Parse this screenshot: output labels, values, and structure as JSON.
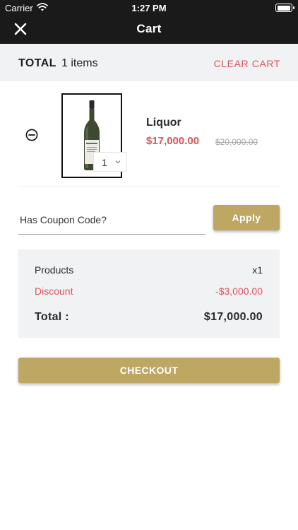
{
  "status_bar": {
    "carrier": "Carrier",
    "time": "1:27 PM"
  },
  "nav": {
    "title": "Cart",
    "close_icon": "close-icon"
  },
  "summary": {
    "total_label": "TOTAL",
    "items_count": "1 items",
    "clear_cart": "CLEAR CART"
  },
  "cart": {
    "items": [
      {
        "name": "Liquor",
        "price": "$17,000.00",
        "original_price": "$20,000.00",
        "quantity": "1"
      }
    ]
  },
  "coupon": {
    "placeholder": "Has Coupon Code?",
    "apply_label": "Apply"
  },
  "totals": {
    "products_label": "Products",
    "products_value": "x1",
    "discount_label": "Discount",
    "discount_value": "-$3,000.00",
    "total_label": "Total :",
    "total_value": "$17,000.00"
  },
  "checkout": {
    "label": "CHECKOUT"
  },
  "colors": {
    "accent": "#bea763",
    "danger": "#e0525b",
    "nav_background": "#1a1a1a",
    "panel": "#f1f2f4"
  }
}
